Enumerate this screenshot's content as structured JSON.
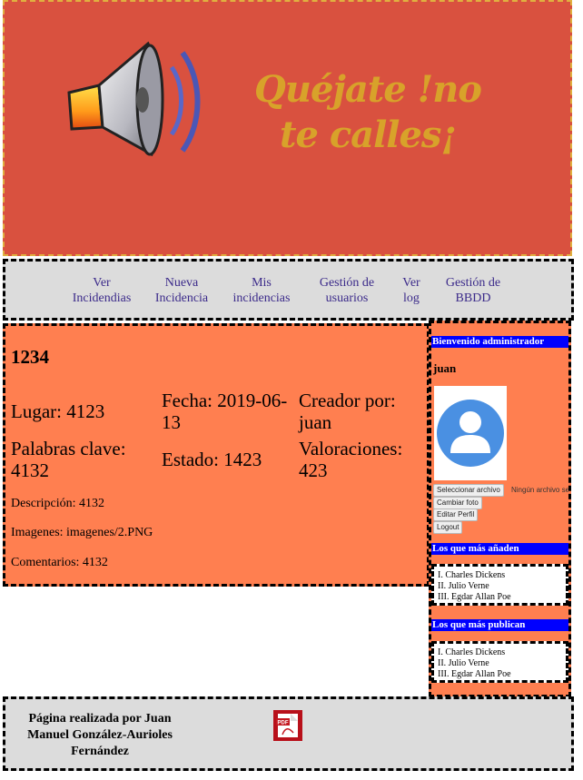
{
  "header": {
    "brand_text": "Quéjate !no te calles¡",
    "logo_icon": "megaphone-icon",
    "colors": {
      "background": "#d9513f",
      "brand": "#d8a22a"
    }
  },
  "nav": {
    "items": [
      {
        "label": "Ver Incidendias"
      },
      {
        "label": "Nueva Incidencia"
      },
      {
        "label": "Mis incidencias"
      },
      {
        "label": "Gestión de usuarios"
      },
      {
        "label": "Ver log"
      },
      {
        "label": "Gestión de BBDD"
      }
    ]
  },
  "incident": {
    "title": "1234",
    "lugar": "Lugar: 4123",
    "fecha": "Fecha: 2019-06-13",
    "creador": "Creador por: juan",
    "palabras": "Palabras clave: 4132",
    "estado": "Estado: 1423",
    "valoraciones": "Valoraciones: 423",
    "descripcion": "Descripción: 4132",
    "imagenes": "Imagenes: imagenes/2.PNG",
    "comentarios": "Comentarios: 4132"
  },
  "sidebar": {
    "welcome": "Bienvenido administrador",
    "username": "juan",
    "avatar_icon": "user-avatar-icon",
    "file_button": "Seleccionar archivo",
    "file_status": "Ningún archivo seleccionado",
    "change_photo": "Cambiar foto",
    "edit_profile": "Editar Perfil",
    "logout": "Logout",
    "top_adders_title": "Los que más añaden",
    "top_adders": [
      "I. Charles Dickens",
      "II. Julio Verne",
      "III. Egdar Allan Poe"
    ],
    "top_publishers_title": "Los que más publican",
    "top_publishers": [
      "I. Charles Dickens",
      "II. Julio Verne",
      "III. Egdar Allan Poe"
    ]
  },
  "footer": {
    "credit": "Página realizada por Juan Manuel González-Aurioles Fernández",
    "pdf_icon": "pdf-icon"
  }
}
